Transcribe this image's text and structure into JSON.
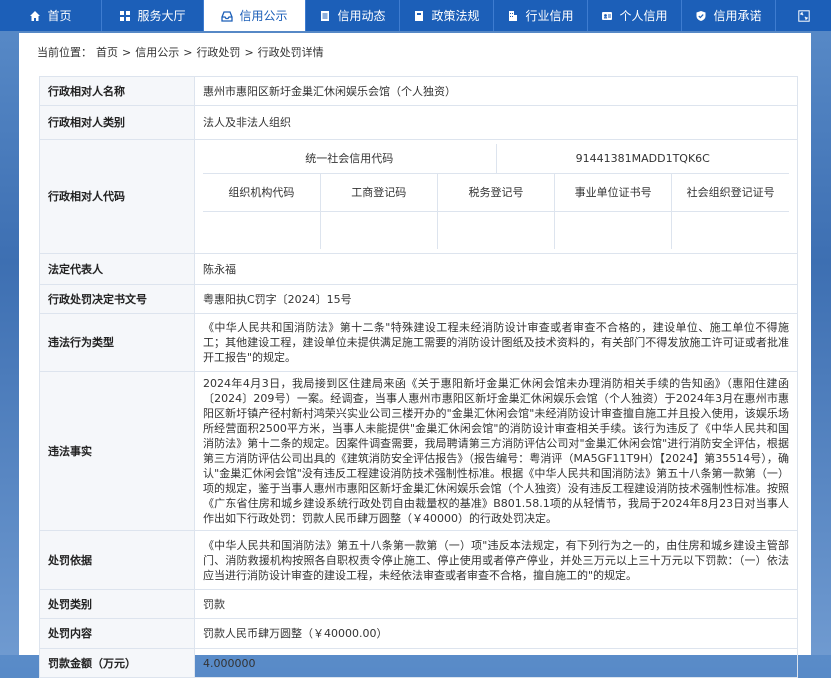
{
  "nav": {
    "items": [
      {
        "label": "首页",
        "icon": "home-icon",
        "active": false
      },
      {
        "label": "服务大厅",
        "icon": "grid-icon",
        "active": false
      },
      {
        "label": "信用公示",
        "icon": "tray-icon",
        "active": true
      },
      {
        "label": "信用动态",
        "icon": "document-icon",
        "active": false
      },
      {
        "label": "政策法规",
        "icon": "book-icon",
        "active": false
      },
      {
        "label": "行业信用",
        "icon": "building-icon",
        "active": false
      },
      {
        "label": "个人信用",
        "icon": "id-card-icon",
        "active": false
      },
      {
        "label": "信用承诺",
        "icon": "shield-check-icon",
        "active": false
      }
    ],
    "expand_icon": "expand-icon"
  },
  "breadcrumb": {
    "prefix": "当前位置：",
    "items": [
      "首页",
      "信用公示",
      "行政处罚",
      "行政处罚详情"
    ],
    "sep": ">"
  },
  "detail": {
    "name_label": "行政相对人名称",
    "name_value": "惠州市惠阳区新圩金巢汇休闲娱乐会馆（个人独资）",
    "category_label": "行政相对人类别",
    "category_value": "法人及非法人组织",
    "code_label": "行政相对人代码",
    "uscc_label": "统一社会信用代码",
    "uscc_value": "91441381MADD1TQK6C",
    "org_code_label": "组织机构代码",
    "biz_reg_label": "工商登记码",
    "tax_reg_label": "税务登记号",
    "inst_cert_label": "事业单位证书号",
    "social_org_label": "社会组织登记证号",
    "rep_label": "法定代表人",
    "rep_value": "陈永福",
    "doc_no_label": "行政处罚决定书文号",
    "doc_no_value": "粤惠阳执C罚字〔2024〕15号",
    "violation_type_label": "违法行为类型",
    "violation_type_value": "《中华人民共和国消防法》第十二条\"特殊建设工程未经消防设计审查或者审查不合格的，建设单位、施工单位不得施工；其他建设工程，建设单位未提供满足施工需要的消防设计图纸及技术资料的，有关部门不得发放施工许可证或者批准开工报告\"的规定。",
    "facts_label": "违法事实",
    "facts_value": "2024年4月3日，我局接到区住建局来函《关于惠阳新圩金巢汇休闲会馆未办理消防相关手续的告知函》（惠阳住建函〔2024〕209号）一案。经调查，当事人惠州市惠阳区新圩金巢汇休闲娱乐会馆（个人独资）于2024年3月在惠州市惠阳区新圩镇产径村新村鸿荣兴实业公司三楼开办的\"金巢汇休闲会馆\"未经消防设计审查擅自施工并且投入使用，该娱乐场所经营面积2500平方米，当事人未能提供\"金巢汇休闲会馆\"的消防设计审查相关手续。该行为违反了《中华人民共和国消防法》第十二条的规定。因案件调查需要，我局聘请第三方消防评估公司对\"金巢汇休闲会馆\"进行消防安全评估，根据第三方消防评估公司出具的《建筑消防安全评估报告》（报告编号：粤消评（MA5GF11T9H）【2024】第35514号），确认\"金巢汇休闲会馆\"没有违反工程建设消防技术强制性标准。根据《中华人民共和国消防法》第五十八条第一款第（一）项的规定，鉴于当事人惠州市惠阳区新圩金巢汇休闲娱乐会馆（个人独资）没有违反工程建设消防技术强制性标准。按照《广东省住房和城乡建设系统行政处罚自由裁量权的基准》B801.58.1项的从轻情节，我局于2024年8月23日对当事人作出如下行政处罚：罚款人民币肆万圆整（￥40000）的行政处罚决定。",
    "basis_label": "处罚依据",
    "basis_value": "《中华人民共和国消防法》第五十八条第一款第（一）项\"违反本法规定，有下列行为之一的，由住房和城乡建设主管部门、消防救援机构按照各自职权责令停止施工、停止使用或者停产停业，并处三万元以上三十万元以下罚款：（一）依法应当进行消防设计审查的建设工程，未经依法审查或者审查不合格，擅自施工的\"的规定。",
    "penalty_type_label": "处罚类别",
    "penalty_type_value": "罚款",
    "penalty_content_label": "处罚内容",
    "penalty_content_value": "罚款人民币肆万圆整（￥40000.00）",
    "fine_label": "罚款金额（万元）",
    "fine_value": "4.000000"
  }
}
